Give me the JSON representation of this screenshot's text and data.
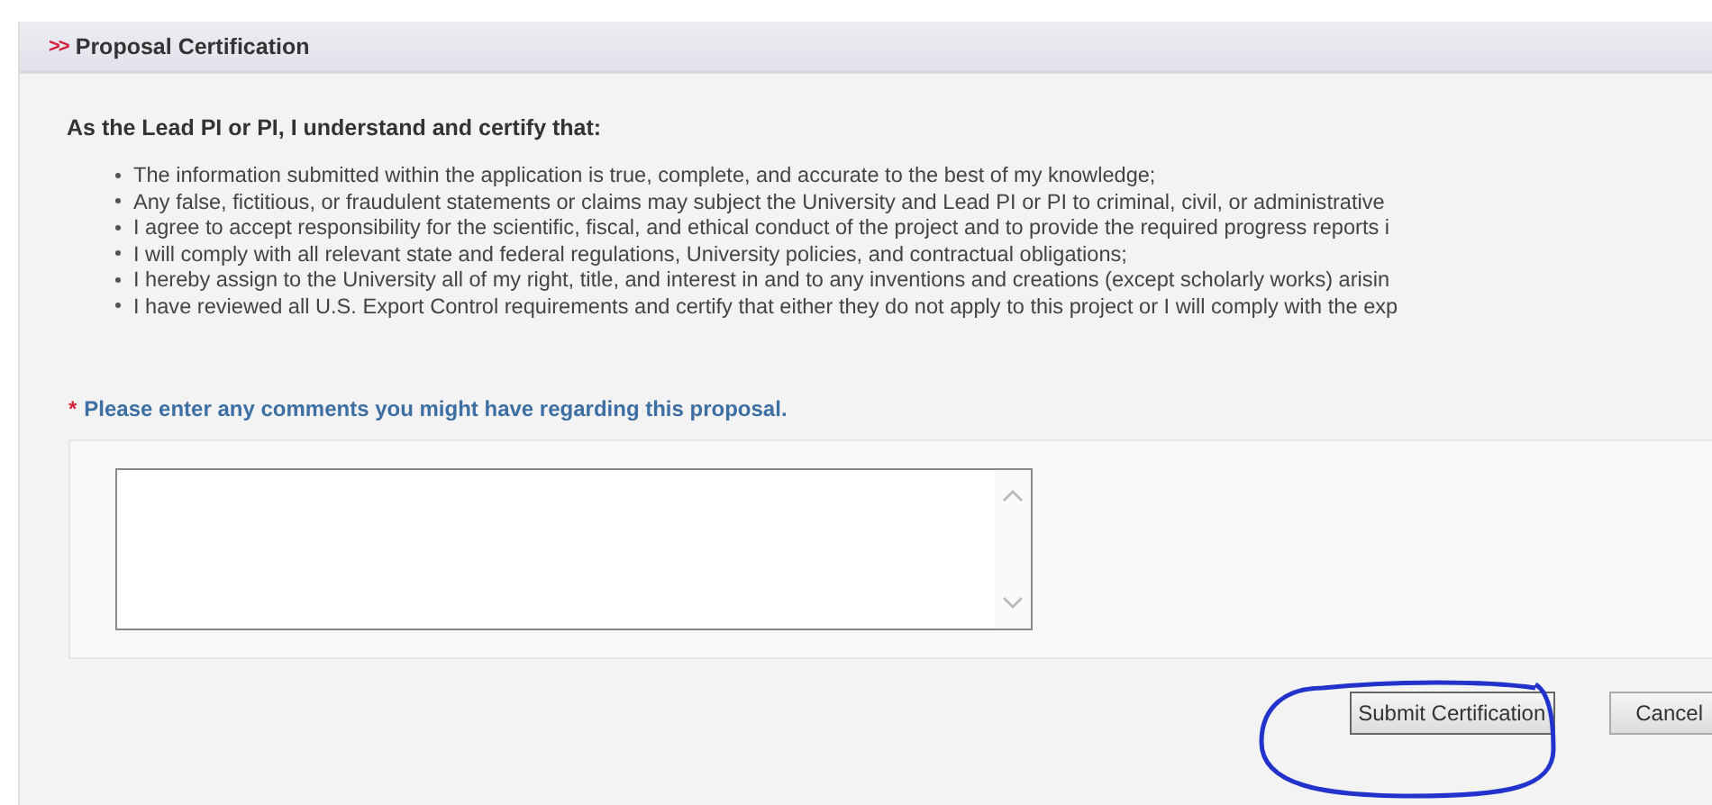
{
  "panel": {
    "marker": ">>",
    "title": "Proposal Certification"
  },
  "statement": "As the Lead PI or PI, I understand and certify that:",
  "certifications": [
    "The information submitted within the application is true, complete, and accurate to the best of my knowledge;",
    "Any false, fictitious, or fraudulent statements or claims may subject the University and Lead PI or PI to criminal, civil, or administrative",
    "I agree to accept responsibility for the scientific, fiscal, and ethical conduct of the project and to provide the required progress reports i",
    "I will comply with all relevant state and federal regulations, University policies, and contractual obligations;",
    "I hereby assign to the University all of my right, title, and interest in and to any inventions and creations (except scholarly works) arisin",
    "I have reviewed all U.S. Export Control requirements and certify that either they do not apply to this project or I will comply with the exp"
  ],
  "comments": {
    "required_mark": "*",
    "label": "Please enter any comments you might have regarding this proposal."
  },
  "buttons": [
    {
      "label": "Submit Certification",
      "circled": true
    },
    {
      "label": "Cancel",
      "circled": false
    }
  ]
}
